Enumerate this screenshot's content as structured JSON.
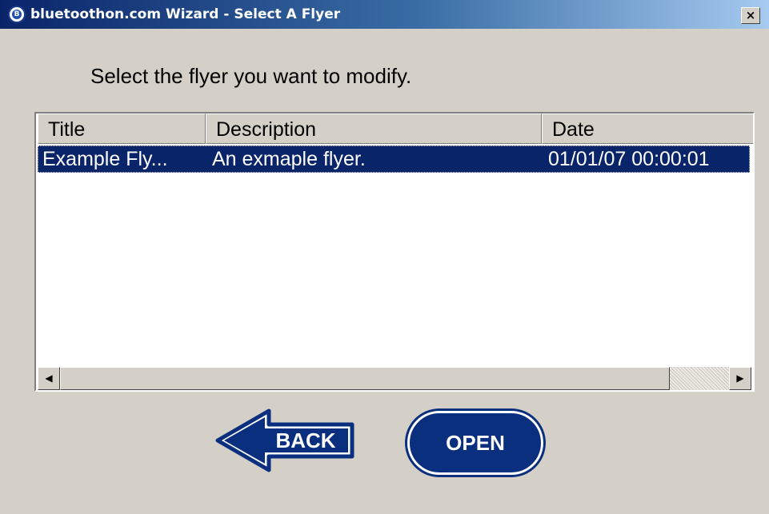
{
  "window": {
    "title": "bluetoothon.com Wizard - Select A Flyer",
    "icon": "bluetoothon-app-icon",
    "icon_glyph": "B",
    "close_glyph": "×"
  },
  "main": {
    "instruction": "Select the flyer you want to modify."
  },
  "table": {
    "columns": [
      "Title",
      "Description",
      "Date"
    ],
    "rows": [
      {
        "title": "Example Fly...",
        "description": "An exmaple flyer.",
        "date": "01/01/07 00:00:01",
        "selected": true
      }
    ]
  },
  "scrollbar": {
    "left_glyph": "◀",
    "right_glyph": "▶"
  },
  "buttons": {
    "back_label": "BACK",
    "open_label": "OPEN"
  },
  "colors": {
    "face": "#d4d0c8",
    "selection": "#0a246a",
    "button_navy": "#0a2f7e"
  }
}
